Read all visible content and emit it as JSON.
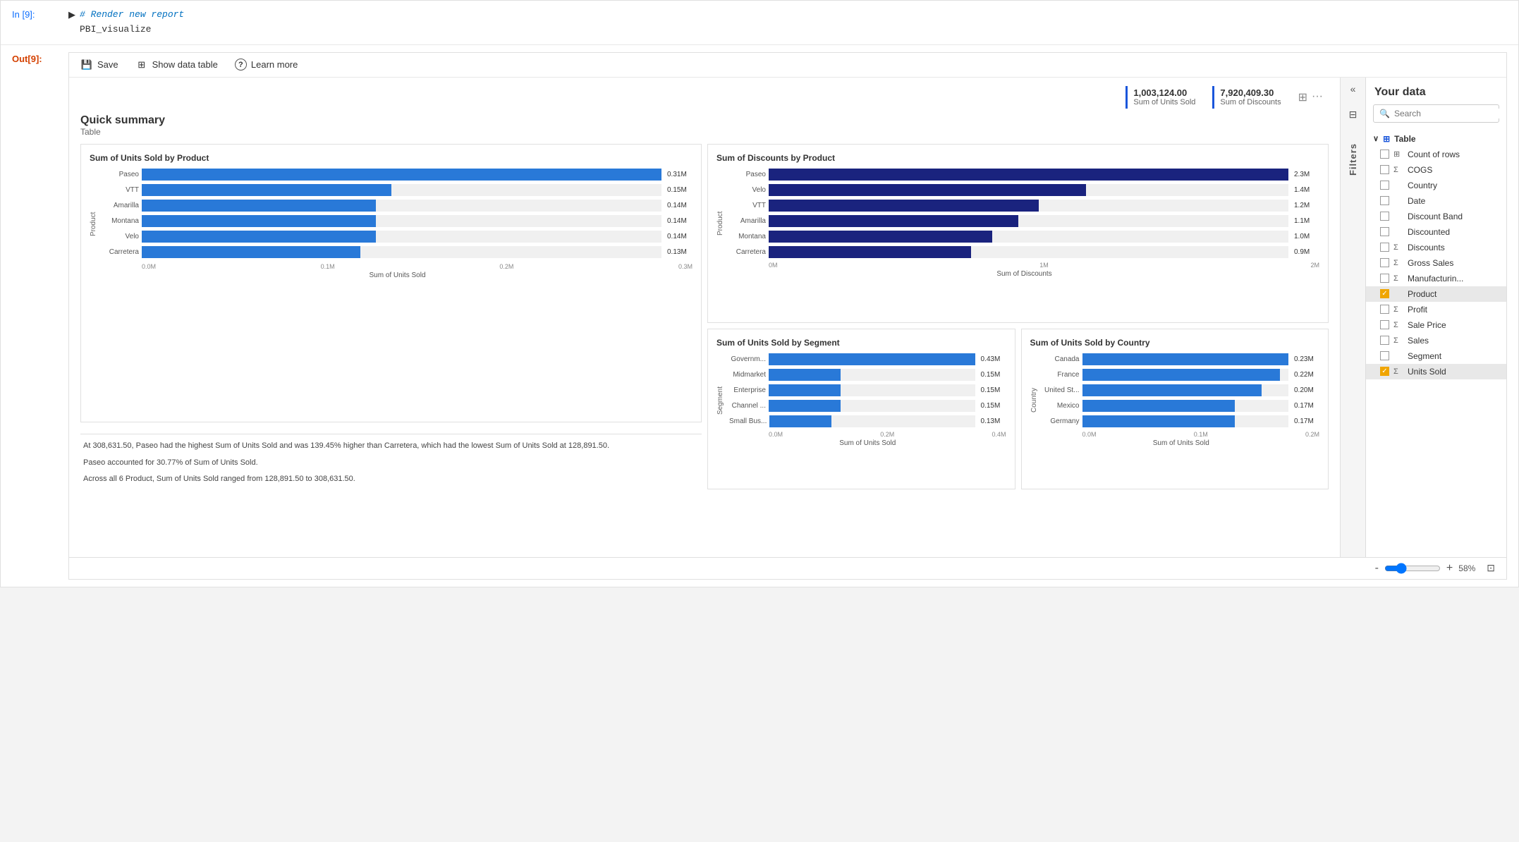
{
  "cell_input": {
    "label": "In [9]:",
    "code_comment": "# Render new report",
    "code_func": "PBI_visualize"
  },
  "cell_output": {
    "label": "Out[9]:"
  },
  "toolbar": {
    "save_label": "Save",
    "show_data_label": "Show data table",
    "learn_more_label": "Learn more"
  },
  "stats": {
    "stat1_value": "1,003,124.00",
    "stat1_label": "Sum of Units Sold",
    "stat2_value": "7,920,409.30",
    "stat2_label": "Sum of Discounts"
  },
  "quick_summary": {
    "title": "Quick summary",
    "subtitle": "Table"
  },
  "charts": {
    "chart1": {
      "title": "Sum of Units Sold by Product",
      "y_axis_label": "Product",
      "x_axis_label": "Sum of Units Sold",
      "x_ticks": [
        "0.0M",
        "0.1M",
        "0.2M",
        "0.3M"
      ],
      "bars": [
        {
          "label": "Paseo",
          "value": 0.31,
          "display": "0.31M",
          "width_pct": 100
        },
        {
          "label": "VTT",
          "value": 0.15,
          "display": "0.15M",
          "width_pct": 48
        },
        {
          "label": "Amarilla",
          "value": 0.14,
          "display": "0.14M",
          "width_pct": 45
        },
        {
          "label": "Montana",
          "value": 0.14,
          "display": "0.14M",
          "width_pct": 45
        },
        {
          "label": "Velo",
          "value": 0.14,
          "display": "0.14M",
          "width_pct": 45
        },
        {
          "label": "Carretera",
          "value": 0.13,
          "display": "0.13M",
          "width_pct": 42
        }
      ]
    },
    "chart2": {
      "title": "Sum of Discounts by Product",
      "y_axis_label": "Product",
      "x_axis_label": "Sum of Discounts",
      "x_ticks": [
        "0M",
        "1M",
        "2M"
      ],
      "bars": [
        {
          "label": "Paseo",
          "value": 2.3,
          "display": "2.3M",
          "width_pct": 100
        },
        {
          "label": "Velo",
          "value": 1.4,
          "display": "1.4M",
          "width_pct": 61
        },
        {
          "label": "VTT",
          "value": 1.2,
          "display": "1.2M",
          "width_pct": 52
        },
        {
          "label": "Amarilla",
          "value": 1.1,
          "display": "1.1M",
          "width_pct": 48
        },
        {
          "label": "Montana",
          "value": 1.0,
          "display": "1.0M",
          "width_pct": 43
        },
        {
          "label": "Carretera",
          "value": 0.9,
          "display": "0.9M",
          "width_pct": 39
        }
      ]
    },
    "chart3": {
      "title": "Sum of Units Sold by Segment",
      "y_axis_label": "Segment",
      "x_axis_label": "Sum of Units Sold",
      "x_ticks": [
        "0.0M",
        "0.2M",
        "0.4M"
      ],
      "bars": [
        {
          "label": "Governm...",
          "value": 0.43,
          "display": "0.43M",
          "width_pct": 100
        },
        {
          "label": "Midmarket",
          "value": 0.15,
          "display": "0.15M",
          "width_pct": 35
        },
        {
          "label": "Enterprise",
          "value": 0.15,
          "display": "0.15M",
          "width_pct": 35
        },
        {
          "label": "Channel ...",
          "value": 0.15,
          "display": "0.15M",
          "width_pct": 35
        },
        {
          "label": "Small Bus...",
          "value": 0.13,
          "display": "0.13M",
          "width_pct": 30
        }
      ]
    },
    "chart4": {
      "title": "Sum of Units Sold by Country",
      "y_axis_label": "Country",
      "x_axis_label": "Sum of Units Sold",
      "x_ticks": [
        "0.0M",
        "0.1M",
        "0.2M"
      ],
      "bars": [
        {
          "label": "Canada",
          "value": 0.23,
          "display": "0.23M",
          "width_pct": 100
        },
        {
          "label": "France",
          "value": 0.22,
          "display": "0.22M",
          "width_pct": 96
        },
        {
          "label": "United St...",
          "value": 0.2,
          "display": "0.20M",
          "width_pct": 87
        },
        {
          "label": "Mexico",
          "value": 0.17,
          "display": "0.17M",
          "width_pct": 74
        },
        {
          "label": "Germany",
          "value": 0.17,
          "display": "0.17M",
          "width_pct": 74
        }
      ]
    }
  },
  "text_summary": {
    "line1": "At 308,631.50, Paseo had the highest Sum of Units Sold and was 139.45% higher than Carretera, which had the lowest Sum of Units Sold at 128,891.50.",
    "line2": "Paseo accounted for 30.77% of Sum of Units Sold.",
    "line3": "Across all 6 Product, Sum of Units Sold ranged from 128,891.50 to 308,631.50."
  },
  "sidebar": {
    "title": "Your data",
    "search_placeholder": "Search",
    "table_label": "Table",
    "items": [
      {
        "id": "count-rows",
        "label": "Count of rows",
        "type": "table",
        "checked": false
      },
      {
        "id": "cogs",
        "label": "COGS",
        "type": "sigma",
        "checked": false
      },
      {
        "id": "country",
        "label": "Country",
        "type": "none",
        "checked": false
      },
      {
        "id": "date",
        "label": "Date",
        "type": "none",
        "checked": false
      },
      {
        "id": "discount-band",
        "label": "Discount Band",
        "type": "none",
        "checked": false
      },
      {
        "id": "discounted",
        "label": "Discounted",
        "type": "none",
        "checked": false
      },
      {
        "id": "discounts",
        "label": "Discounts",
        "type": "sigma",
        "checked": false
      },
      {
        "id": "gross-sales",
        "label": "Gross Sales",
        "type": "sigma",
        "checked": false
      },
      {
        "id": "manufacturing",
        "label": "Manufacturin...",
        "type": "sigma",
        "checked": false
      },
      {
        "id": "product",
        "label": "Product",
        "type": "none",
        "checked": true,
        "selected": true
      },
      {
        "id": "profit",
        "label": "Profit",
        "type": "sigma",
        "checked": false
      },
      {
        "id": "sale-price",
        "label": "Sale Price",
        "type": "sigma",
        "checked": false
      },
      {
        "id": "sales",
        "label": "Sales",
        "type": "sigma",
        "checked": false
      },
      {
        "id": "segment",
        "label": "Segment",
        "type": "none",
        "checked": false
      },
      {
        "id": "units-sold",
        "label": "Units Sold",
        "type": "sigma",
        "checked": true,
        "selected": true
      }
    ]
  },
  "zoom": {
    "level": "58%",
    "minus": "-",
    "plus": "+"
  },
  "filters_label": "Filters",
  "icons": {
    "save": "💾",
    "table": "⊞",
    "question": "?",
    "search": "🔍",
    "chevron_left": "«",
    "chevron_right": "»",
    "filter": "⊟",
    "sigma": "Σ",
    "table_icon": "⊞",
    "run": "▶"
  }
}
